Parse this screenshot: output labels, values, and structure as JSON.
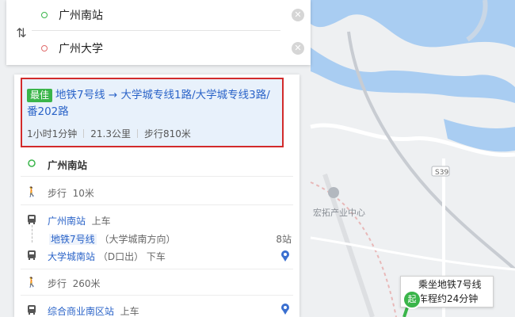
{
  "search": {
    "start": "广州南站",
    "end": "广州大学",
    "swap_icon": "swap-vertical",
    "clear_icon": "close"
  },
  "route": {
    "tag": "最佳",
    "title": "地铁7号线 → 大学城专线1路/大学城专线3路/番202路",
    "duration": "1小时1分钟",
    "distance": "21.3公里",
    "walk": "步行810米",
    "highlight_color": "#d22b2b"
  },
  "steps": {
    "origin": "广州南站",
    "walk1": "步行",
    "walk1_dist": "10米",
    "board1_station": "广州南站",
    "board1_action": "上车",
    "line1": "地铁7号线",
    "line1_dir": "（大学城南方向）",
    "line1_stops": "8站",
    "alight1_station": "大学城南站",
    "alight1_exit": "（D口出）",
    "alight1_action": "下车",
    "walk2": "步行",
    "walk2_dist": "260米",
    "board2_station": "综合商业南区站",
    "board2_action": "上车"
  },
  "map": {
    "poi_label": "宏拓产业中心",
    "road_label": "S39",
    "callout_line1": "乘坐地铁7号线",
    "callout_line2": "车程约24分钟",
    "start_marker": "起"
  }
}
